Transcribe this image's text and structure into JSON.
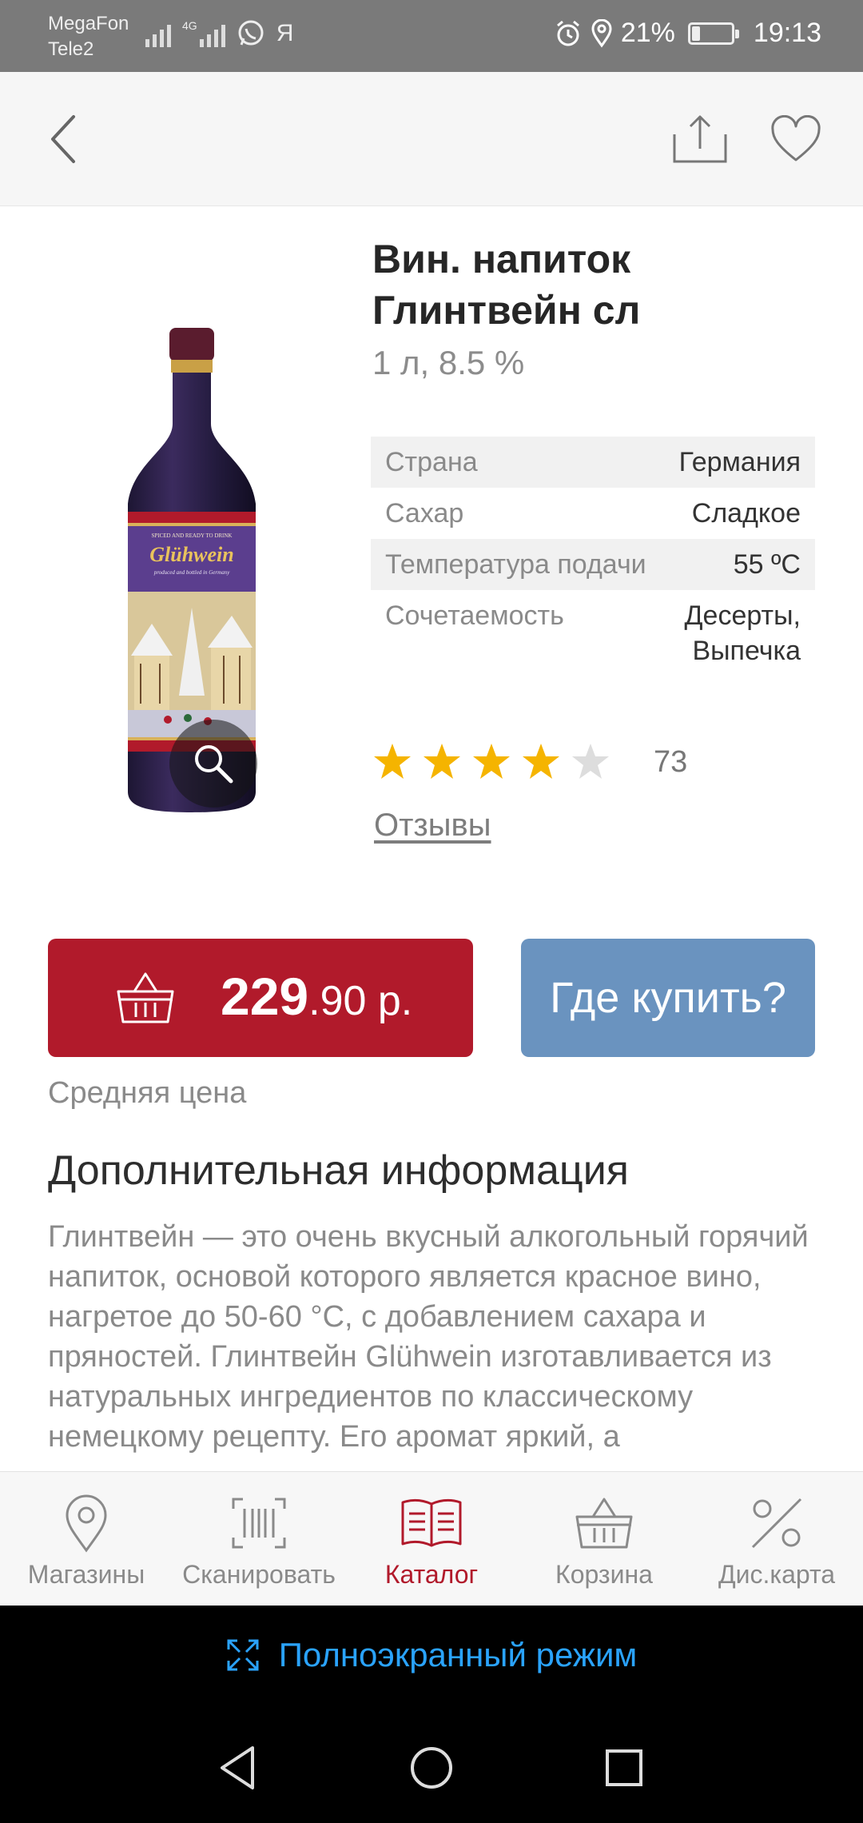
{
  "status_bar": {
    "carrier1": "MegaFon",
    "carrier2": "Tele2",
    "network": "4G",
    "extra_app": "Я",
    "battery_text": "21%",
    "battery_level": 0.21,
    "time": "19:13"
  },
  "product": {
    "title": "Вин. напиток Глинтвейн сл",
    "volume": "1 л, 8.5 %",
    "image_label_1": "SPICED AND READY TO DRINK",
    "image_brand": "Glühwein",
    "image_label_2": "produced and bottled in Germany",
    "properties": [
      {
        "label": "Страна",
        "value": "Германия"
      },
      {
        "label": "Сахар",
        "value": "Сладкое"
      },
      {
        "label": "Температура подачи",
        "value": "55 ºC"
      },
      {
        "label": "Сочетаемость",
        "value": "Десерты,\nВыпечка"
      }
    ],
    "rating": 4,
    "rating_max": 5,
    "rating_count": "73",
    "reviews_link": "Отзывы"
  },
  "price": {
    "main": "229",
    "rest": ".90 р.",
    "where_to_buy": "Где купить?",
    "avg_label": "Средняя цена"
  },
  "info": {
    "heading": "Дополнительная информация",
    "text": "Глинтвейн — это очень вкусный алкогольный горячий напиток, основой которого является красное вино, нагретое до 50-60 °C, с добавлением сахара и пряностей. Глинтвейн Glühwein изготавливается из натуральных ингредиентов по классическому немецкому рецепту. Его аромат яркий, а"
  },
  "bottom_nav": [
    {
      "label": "Магазины",
      "icon": "map-pin-icon"
    },
    {
      "label": "Сканировать",
      "icon": "barcode-scan-icon"
    },
    {
      "label": "Каталог",
      "icon": "catalog-book-icon"
    },
    {
      "label": "Корзина",
      "icon": "basket-icon"
    },
    {
      "label": "Дис.карта",
      "icon": "percent-icon"
    }
  ],
  "fullscreen": {
    "label": "Полноэкранный режим"
  },
  "colors": {
    "accent_red": "#b11a2b",
    "accent_blue": "#6a93bf",
    "star_gold": "#f5b400",
    "star_gray": "#dddddd",
    "link_blue": "#2aa3ff"
  }
}
